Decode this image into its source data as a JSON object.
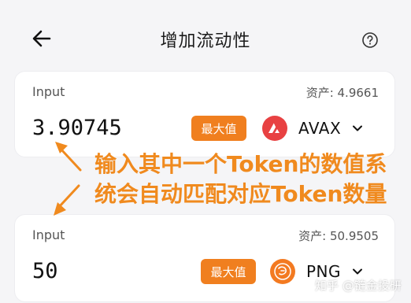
{
  "header": {
    "title": "增加流动性",
    "back_icon": "arrow-left-icon",
    "help_icon": "question-circle-icon"
  },
  "input_top": {
    "label": "Input",
    "balance": "资产: 4.9661",
    "amount": "3.90745",
    "max_label": "最大值",
    "token": "AVAX",
    "token_icon": "avax-logo-icon"
  },
  "input_bottom": {
    "label": "Input",
    "balance": "资产: 50.9505",
    "amount": "50",
    "max_label": "最大值",
    "token": "PNG",
    "token_icon": "png-logo-icon"
  },
  "annotation": {
    "line1": "输入其中一个Token的数值系",
    "line2": "统会自动匹配对应Token数量"
  },
  "watermark": "知乎 @链金投研",
  "colors": {
    "accent": "#f07f1f",
    "avax": "#e84142",
    "png": "#f37a21",
    "annotation": "#f08a1e"
  }
}
